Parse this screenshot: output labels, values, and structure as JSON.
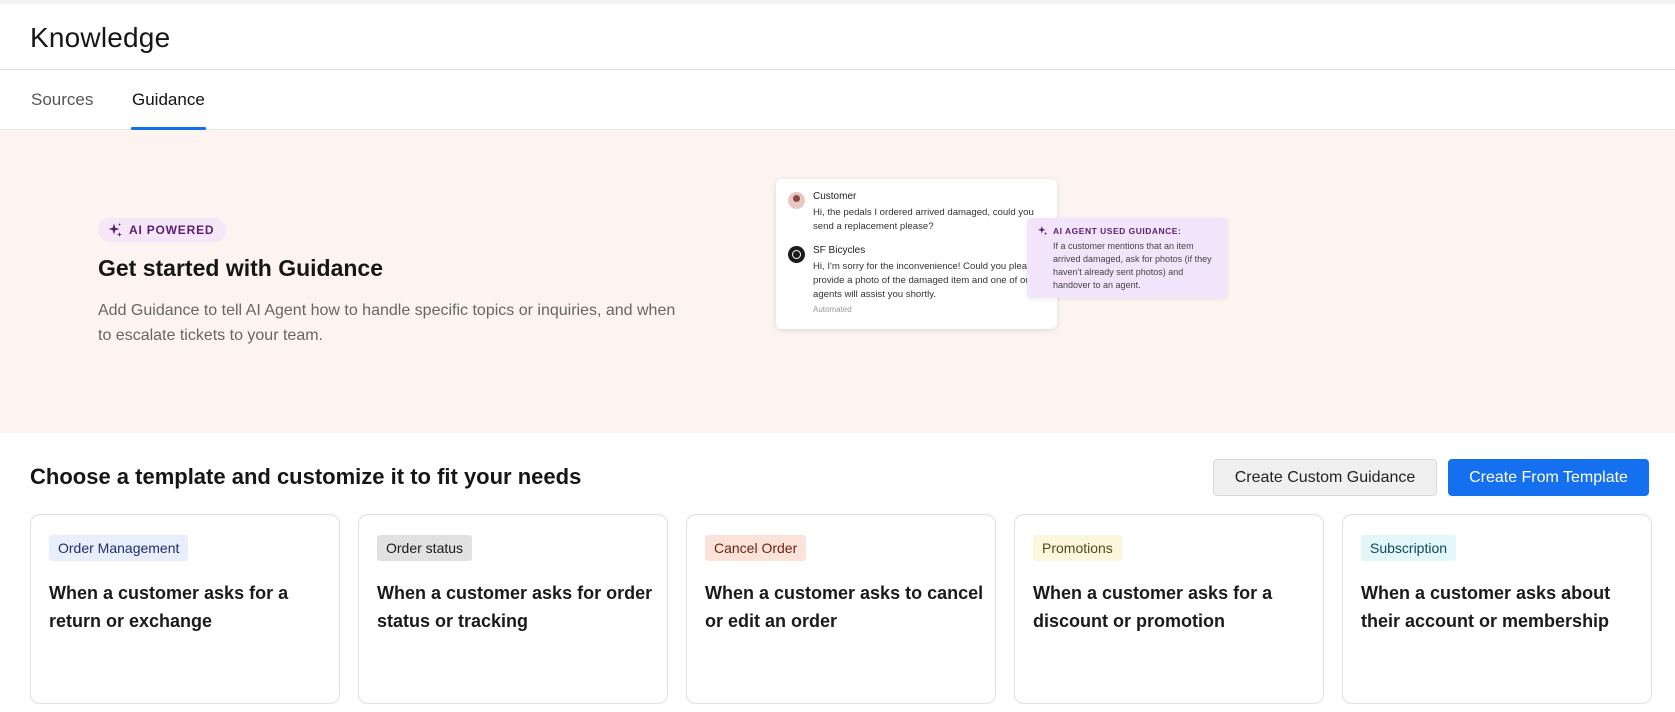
{
  "header": {
    "title": "Knowledge"
  },
  "tabs": [
    {
      "label": "Sources",
      "active": false
    },
    {
      "label": "Guidance",
      "active": true
    }
  ],
  "hero": {
    "badge": "AI POWERED",
    "title": "Get started with Guidance",
    "description": "Add Guidance to tell AI Agent how to handle specific topics or inquiries, and when to escalate tickets to your team.",
    "chat": {
      "customer_name": "Customer",
      "customer_message": "Hi, the pedals I ordered arrived damaged, could you send a replacement please?",
      "agent_name": "SF Bicycles",
      "agent_message": "Hi, I'm sorry for the inconvenience! Could you please provide a photo of the damaged item and one of our agents will assist you shortly.",
      "agent_meta": "Automated"
    },
    "guidance_note": {
      "label": "AI AGENT USED GUIDANCE:",
      "text": "If a customer mentions that an item arrived damaged, ask for photos (if they haven't already sent photos) and handover to an agent."
    }
  },
  "templates": {
    "title": "Choose a template and customize it to fit your needs",
    "create_custom_label": "Create Custom Guidance",
    "create_template_label": "Create From Template",
    "cards": [
      {
        "tag": "Order Management",
        "tag_bg": "#e8eefb",
        "tag_color": "#1e2f6b",
        "text": "When a customer asks for a return or exchange"
      },
      {
        "tag": "Order status",
        "tag_bg": "#e1e1e1",
        "tag_color": "#1a1a1a",
        "text": "When a customer asks for order status or tracking"
      },
      {
        "tag": "Cancel Order",
        "tag_bg": "#fbe3da",
        "tag_color": "#6b2410",
        "text": "When a customer asks to cancel or edit an order"
      },
      {
        "tag": "Promotions",
        "tag_bg": "#fcf6dc",
        "tag_color": "#5a4a14",
        "text": "When a customer asks for a discount or promotion"
      },
      {
        "tag": "Subscription",
        "tag_bg": "#e3f6fa",
        "tag_color": "#0e4a5a",
        "text": "When a customer asks about their account or membership"
      }
    ]
  },
  "colors": {
    "accent": "#1570ef",
    "hero_bg": "#fdf4f1",
    "badge_bg": "#f5e6f8",
    "badge_text": "#5a1f6d"
  }
}
